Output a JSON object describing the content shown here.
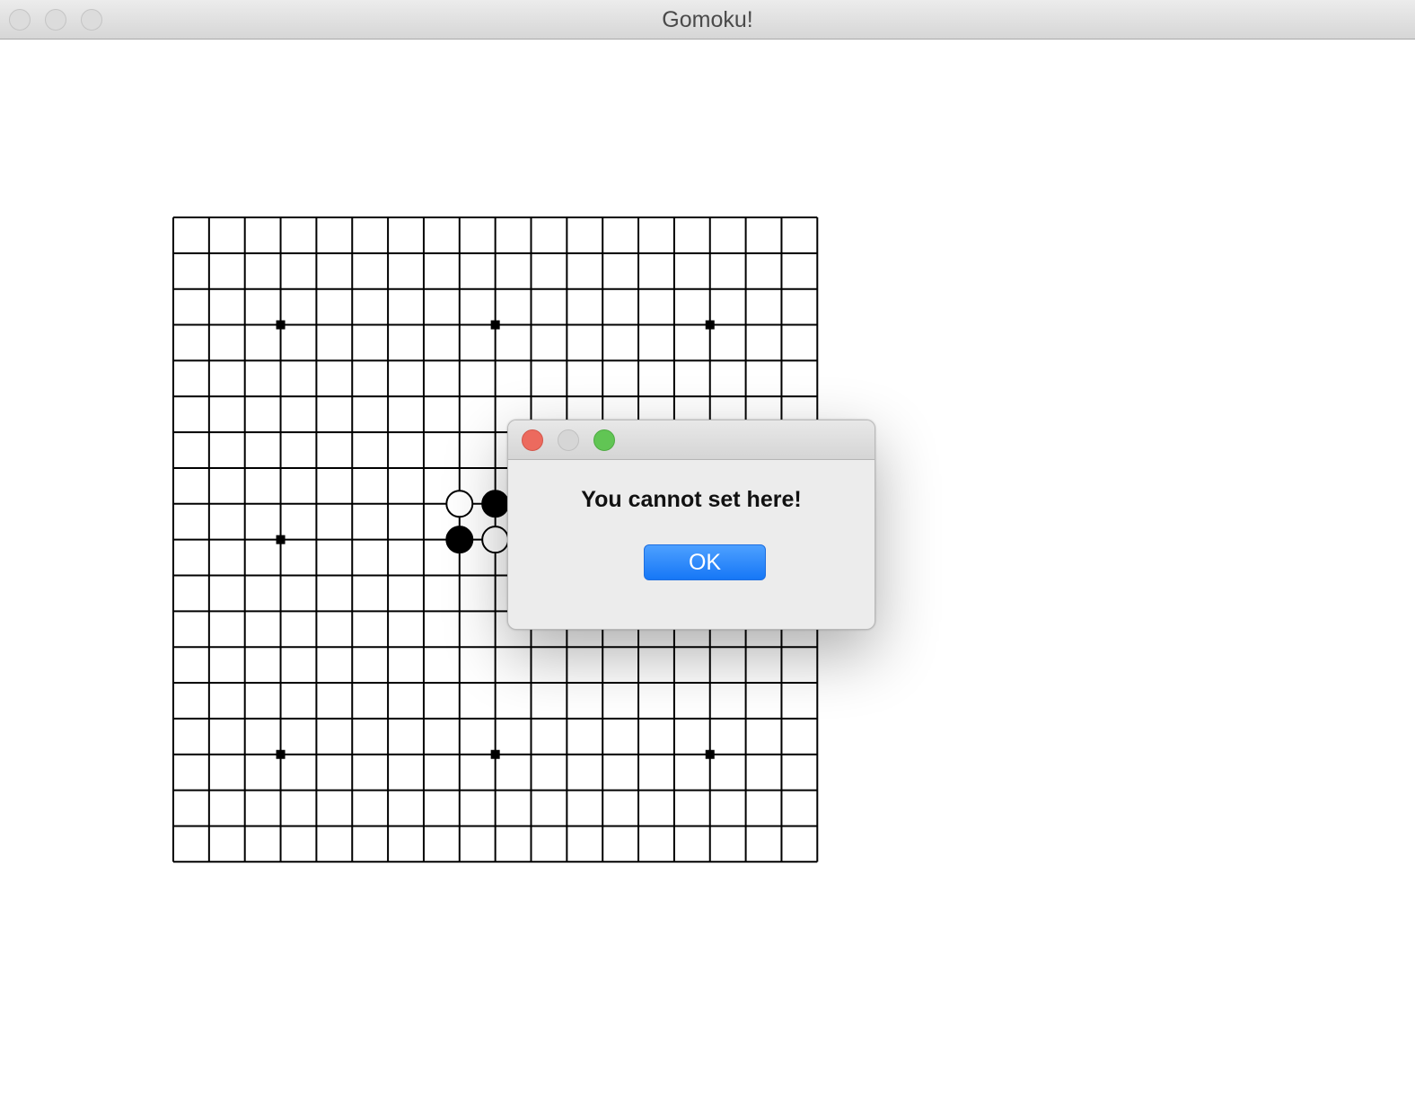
{
  "window": {
    "title": "Gomoku!"
  },
  "board": {
    "grid_lines": 19,
    "star_points": [
      [
        3,
        3
      ],
      [
        9,
        3
      ],
      [
        15,
        3
      ],
      [
        3,
        9
      ],
      [
        3,
        15
      ],
      [
        9,
        15
      ],
      [
        15,
        15
      ]
    ],
    "stones": [
      {
        "col": 8,
        "row": 8,
        "color": "white"
      },
      {
        "col": 9,
        "row": 8,
        "color": "black"
      },
      {
        "col": 8,
        "row": 9,
        "color": "black"
      },
      {
        "col": 9,
        "row": 9,
        "color": "white"
      }
    ],
    "line_color": "#000000",
    "background": "#ffffff"
  },
  "dialog": {
    "message": "You cannot set here!",
    "ok_label": "OK",
    "close_color": "#ec6a5e",
    "minimize_color": "#d6d6d6",
    "maximize_color": "#61c554",
    "button_color": "#1677f6"
  }
}
